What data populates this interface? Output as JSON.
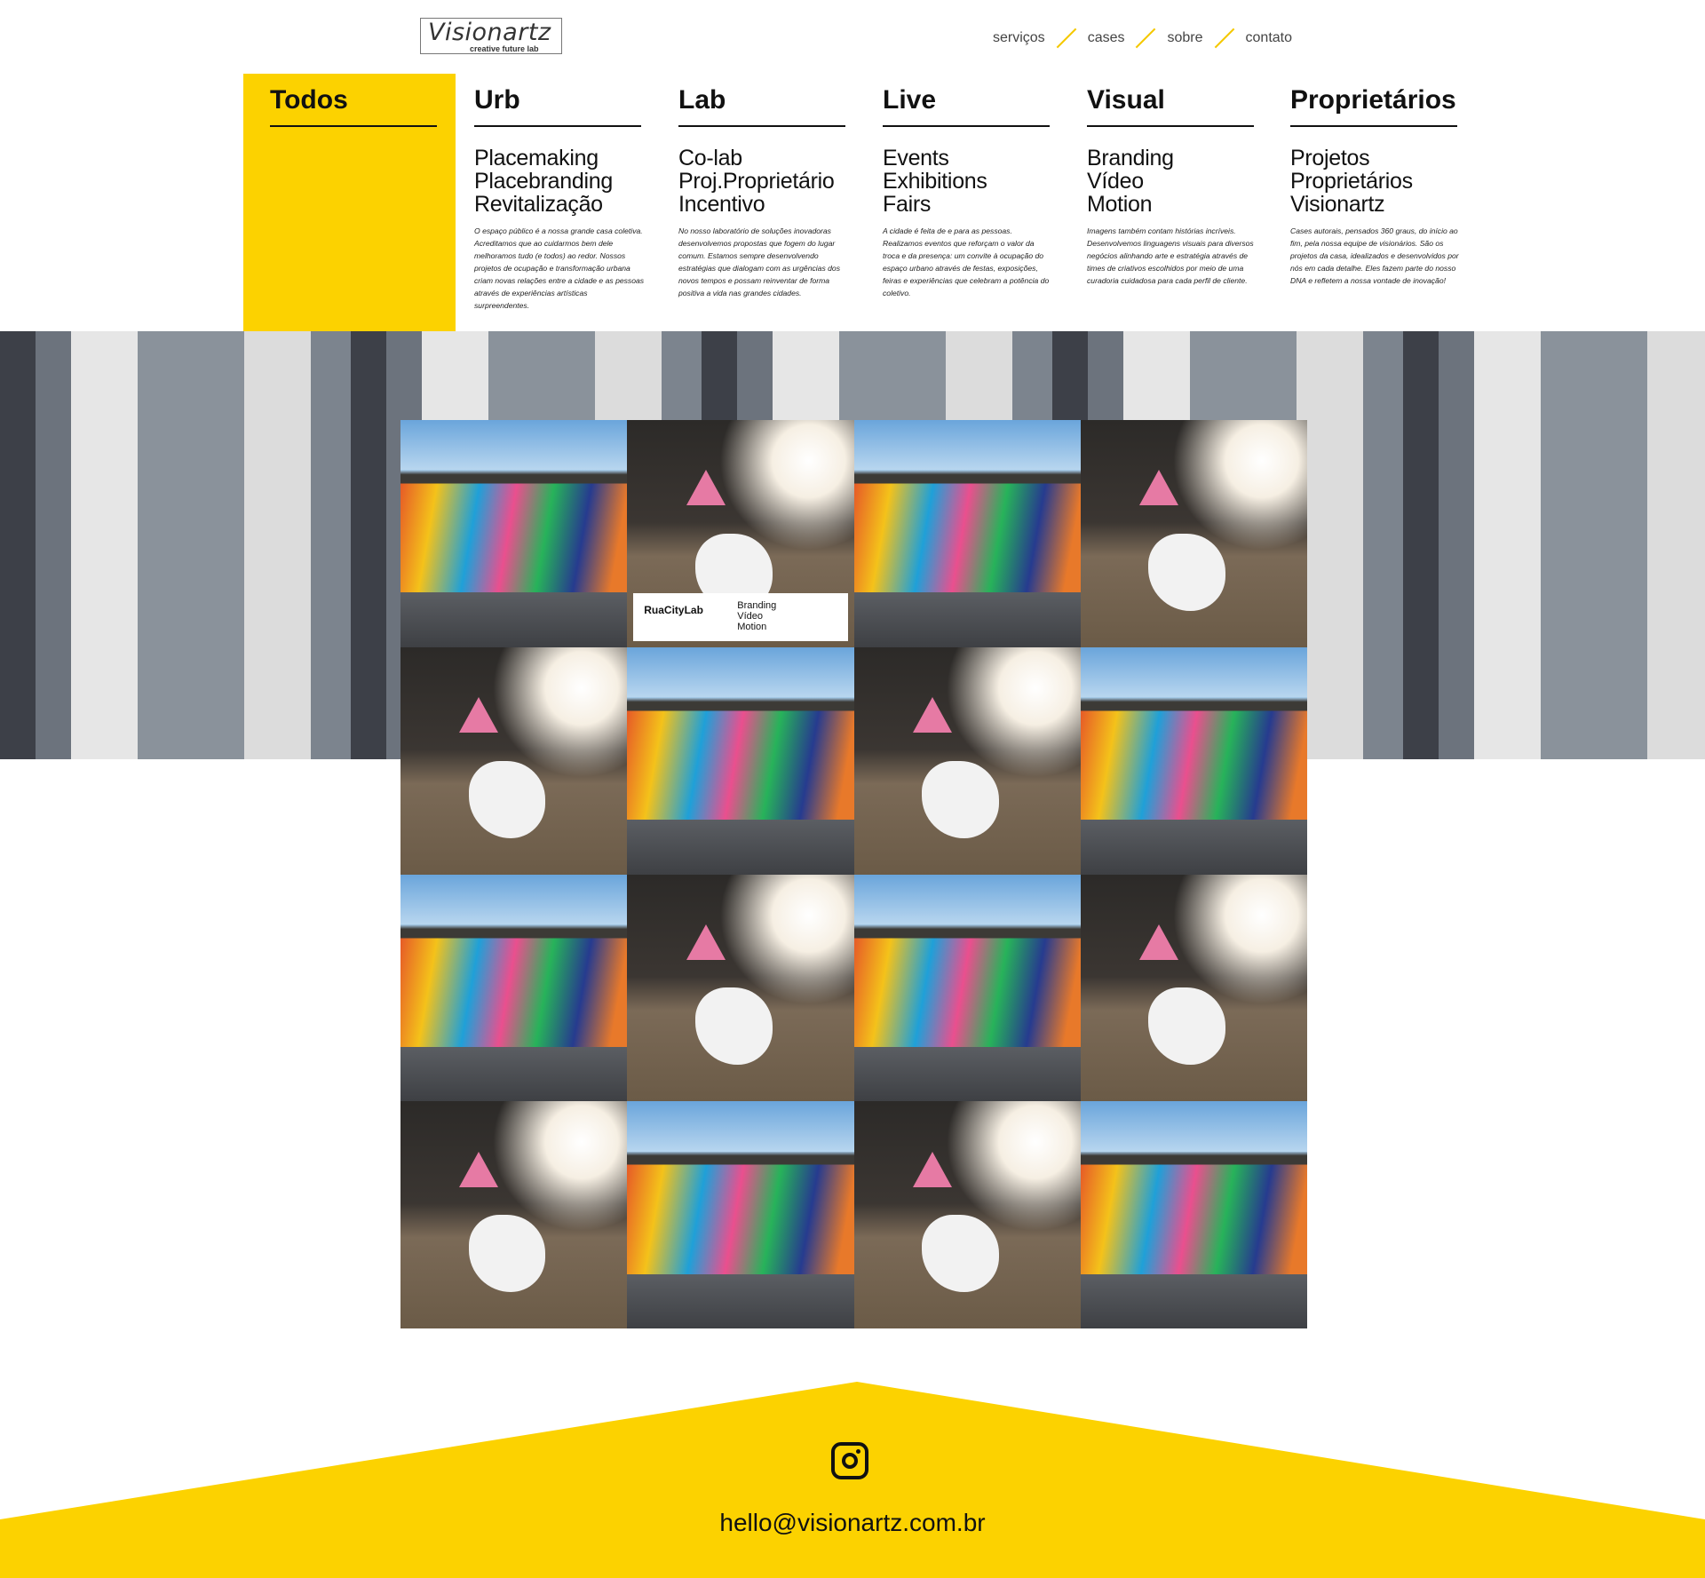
{
  "brand": {
    "logo_text": "Visionartz",
    "logo_subtitle": "creative future lab"
  },
  "nav": [
    "serviços",
    "cases",
    "sobre",
    "contato"
  ],
  "categories": [
    {
      "title": "Todos",
      "items": [],
      "description": ""
    },
    {
      "title": "Urb",
      "items": [
        "Placemaking",
        "Placebranding",
        "Revitalização"
      ],
      "description": "O espaço público é a nossa grande casa coletiva. Acreditamos que ao cuidarmos bem dele melhoramos tudo (e todos) ao redor. Nossos projetos de ocupação e transformação urbana criam novas relações entre a cidade e as pessoas através de experiências artísticas surpreendentes."
    },
    {
      "title": "Lab",
      "items": [
        "Co-lab",
        "Proj.Proprietário",
        "Incentivo"
      ],
      "description": "No nosso laboratório de soluções inovadoras desenvolvemos propostas que fogem do lugar comum. Estamos sempre desenvolvendo estratégias que dialogam com as urgências dos novos tempos e possam reinventar de forma positiva a vida nas grandes cidades."
    },
    {
      "title": "Live",
      "items": [
        "Events",
        "Exhibitions",
        "Fairs"
      ],
      "description": "A cidade é feita de e para as pessoas. Realizamos eventos que reforçam o valor da troca e da presença: um convite à ocupação do espaço urbano através de festas, exposições, feiras e experiências que celebram a potência do coletivo."
    },
    {
      "title": "Visual",
      "items": [
        "Branding",
        "Vídeo",
        "Motion"
      ],
      "description": "Imagens também contam histórias incríveis. Desenvolvemos linguagens visuais para diversos negócios alinhando arte e estratégia através de times de criativos escolhidos por meio de uma curadoria cuidadosa para cada perfil de cliente."
    },
    {
      "title": "Proprietários",
      "items": [
        "Projetos",
        "Proprietários",
        "Visionartz"
      ],
      "description": "Cases autorais, pensados 360 graus, do início ao fim, pela nossa equipe de visionários. São os projetos da casa, idealizados e desenvolvidos por nós em cada detalhe. Eles fazem parte do nosso DNA e refletem a nossa vontade de inovação!"
    }
  ],
  "active_category": "Todos",
  "grid": {
    "tiles": [
      "mural",
      "dog",
      "mural",
      "dog",
      "dog",
      "mural",
      "dog",
      "mural",
      "mural",
      "dog",
      "mural",
      "dog",
      "dog",
      "mural",
      "dog",
      "mural"
    ],
    "hover_card": {
      "tile_index": 1,
      "name": "RuaCityLab",
      "tags": [
        "Branding",
        "Vídeo",
        "Motion"
      ]
    }
  },
  "footer": {
    "email": "hello@visionartz.com.br",
    "social_icon": "instagram-icon"
  },
  "colors": {
    "accent": "#fcd200"
  }
}
